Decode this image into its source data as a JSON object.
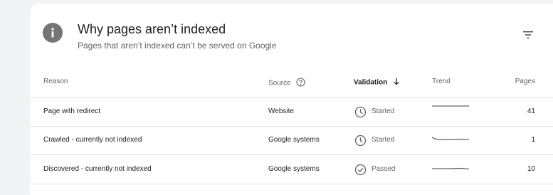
{
  "header": {
    "icon": "info-icon",
    "title": "Why pages aren’t indexed",
    "subtitle": "Pages that aren’t indexed can’t be served on Google",
    "filter_icon": "filter-icon"
  },
  "columns": {
    "reason": "Reason",
    "source": "Source",
    "validation": "Validation",
    "trend": "Trend",
    "pages": "Pages"
  },
  "rows": [
    {
      "reason": "Page with redirect",
      "source": "Website",
      "validation": "Started",
      "validation_icon": "clock-icon",
      "pages": "41"
    },
    {
      "reason": "Crawled - currently not indexed",
      "source": "Google systems",
      "validation": "Started",
      "validation_icon": "clock-icon",
      "pages": "1"
    },
    {
      "reason": "Discovered - currently not indexed",
      "source": "Google systems",
      "validation": "Passed",
      "validation_icon": "check-circle-icon",
      "pages": "10"
    }
  ],
  "colors": {
    "background": "#f1f3f4",
    "card": "#ffffff",
    "text": "#202124",
    "muted_text": "#5f6368",
    "icon_gray": "#757575",
    "divider": "#e0e0e0",
    "sparkline": "#5f6368"
  }
}
